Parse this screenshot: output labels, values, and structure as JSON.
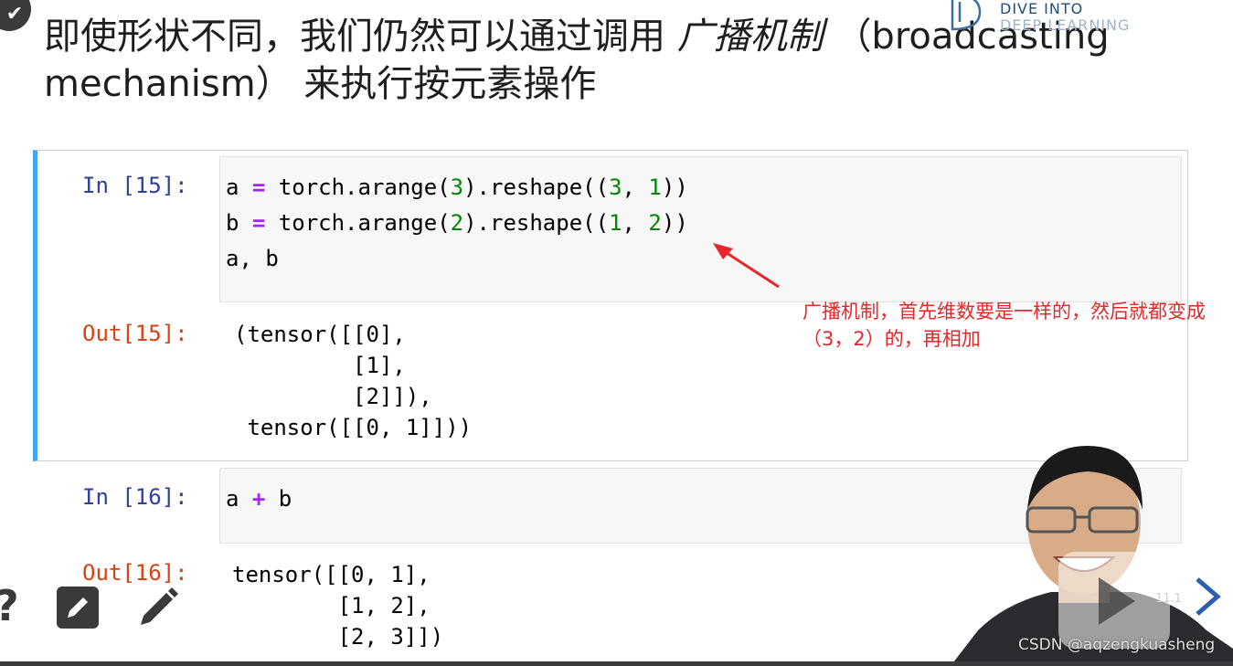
{
  "header": {
    "title_prefix": "即使形状不同，我们仍然可以通过调用",
    "title_emphasis": "广播机制",
    "title_suffix": "（broadcasting mechanism） 来执行按元素操作",
    "logo_line1": "DIVE INTO",
    "logo_line2": "DEEP LEARNING"
  },
  "cells": [
    {
      "in_prompt": "In [15]:",
      "code_lines": [
        [
          {
            "t": "a ",
            "c": ""
          },
          {
            "t": "=",
            "c": "op"
          },
          {
            "t": " torch.arange(",
            "c": ""
          },
          {
            "t": "3",
            "c": "num"
          },
          {
            "t": ").reshape((",
            "c": ""
          },
          {
            "t": "3",
            "c": "num"
          },
          {
            "t": ", ",
            "c": ""
          },
          {
            "t": "1",
            "c": "num"
          },
          {
            "t": "))",
            "c": ""
          }
        ],
        [
          {
            "t": "b ",
            "c": ""
          },
          {
            "t": "=",
            "c": "op"
          },
          {
            "t": " torch.arange(",
            "c": ""
          },
          {
            "t": "2",
            "c": "num"
          },
          {
            "t": ").reshape((",
            "c": ""
          },
          {
            "t": "1",
            "c": "num"
          },
          {
            "t": ", ",
            "c": ""
          },
          {
            "t": "2",
            "c": "num"
          },
          {
            "t": "))",
            "c": ""
          }
        ],
        [
          {
            "t": "a, b",
            "c": ""
          }
        ]
      ],
      "out_prompt": "Out[15]:",
      "output_text": "(tensor([[0],\n         [1],\n         [2]]),\n tensor([[0, 1]]))"
    },
    {
      "in_prompt": "In [16]:",
      "code_lines": [
        [
          {
            "t": "a ",
            "c": ""
          },
          {
            "t": "+",
            "c": "op"
          },
          {
            "t": " b",
            "c": ""
          }
        ]
      ],
      "out_prompt": "Out[16]:",
      "output_text": "tensor([[0, 1],\n        [1, 2],\n        [2, 3]])"
    }
  ],
  "annotation": {
    "text": "广播机制，首先维数要是一样的，然后就都变成（3，2）的，再相加",
    "color": "#e8262a"
  },
  "toolbar": {
    "help_icon": "?",
    "edit_icon": "edit-box-icon",
    "pencil_icon": "pencil-icon"
  },
  "player": {
    "slide_number": "11.1",
    "watermark": "CSDN @aqzengkuasheng"
  },
  "colors": {
    "in_prompt": "#303f9f",
    "out_prompt": "#d84315",
    "selected_cell_bar": "#42a5f5",
    "operator": "#aa22ff",
    "number": "#008800"
  }
}
